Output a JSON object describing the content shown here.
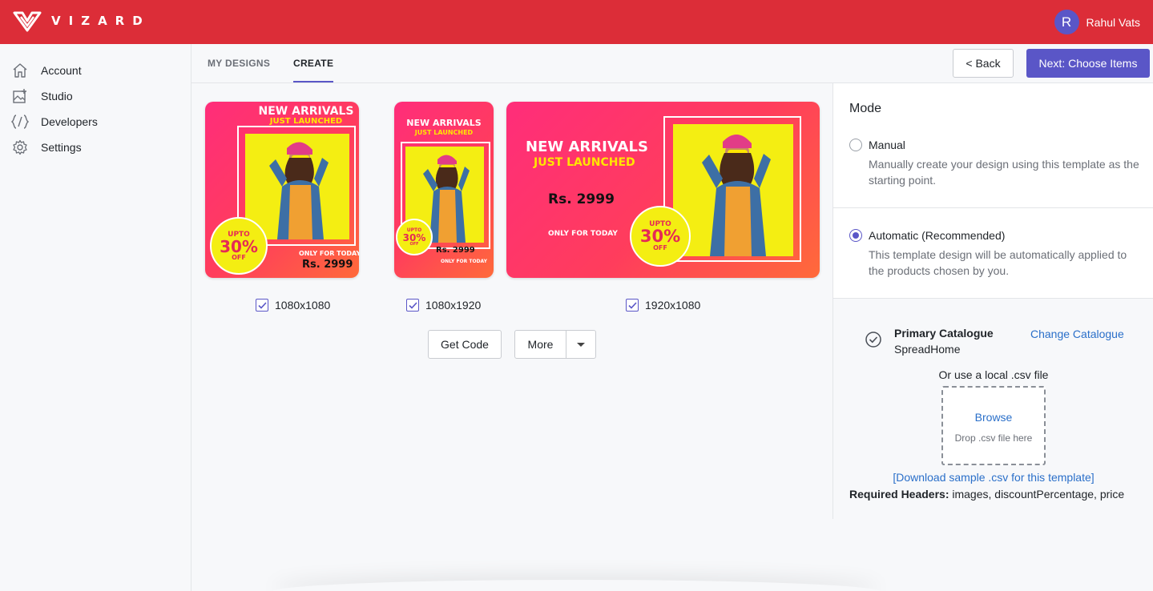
{
  "app": {
    "logo_text": "VIZARD"
  },
  "user": {
    "initial": "R",
    "name": "Rahul Vats"
  },
  "sidebar": {
    "items": [
      {
        "label": "Account",
        "icon": "home-icon"
      },
      {
        "label": "Studio",
        "icon": "studio-icon"
      },
      {
        "label": "Developers",
        "icon": "code-icon"
      },
      {
        "label": "Settings",
        "icon": "gear-icon"
      }
    ]
  },
  "tabs": {
    "my_designs": "MY DESIGNS",
    "create": "CREATE",
    "active": "CREATE"
  },
  "header": {
    "back_label": "< Back",
    "next_label": "Next: Choose Items"
  },
  "designs": [
    {
      "size": "1080x1080",
      "checked": true,
      "headline": "NEW ARRIVALS",
      "sub": "JUST LAUNCHED",
      "price": "Rs. 2999",
      "only": "ONLY FOR TODAY",
      "badge_top": "UPTO",
      "badge_pct": "30%",
      "badge_bottom": "OFF"
    },
    {
      "size": "1080x1920",
      "checked": true,
      "headline": "NEW ARRIVALS",
      "sub": "JUST LAUNCHED",
      "price": "Rs. 2999",
      "only": "ONLY FOR TODAY",
      "badge_top": "UPTO",
      "badge_pct": "30%",
      "badge_bottom": "OFF"
    },
    {
      "size": "1920x1080",
      "checked": true,
      "headline": "NEW ARRIVALS",
      "sub": "JUST LAUNCHED",
      "price": "Rs. 2999",
      "only": "ONLY FOR TODAY",
      "badge_top": "UPTO",
      "badge_pct": "30%",
      "badge_bottom": "OFF"
    }
  ],
  "actions": {
    "get_code": "Get Code",
    "more": "More"
  },
  "mode": {
    "title": "Mode",
    "options": [
      {
        "label": "Manual",
        "description": "Manually create your design using this template as the starting point.",
        "selected": false
      },
      {
        "label": "Automatic (Recommended)",
        "description": "This template design will be automatically applied to the products chosen by you.",
        "selected": true
      }
    ]
  },
  "catalogue": {
    "title": "Primary Catalogue",
    "name": "SpreadHome",
    "change_label": "Change Catalogue",
    "local_csv_label": "Or use a local .csv file",
    "browse_label": "Browse",
    "drop_text": "Drop .csv file here",
    "download_label": "[Download sample .csv for this template]",
    "required_headers_label": "Required Headers:",
    "required_headers_value": " images, discountPercentage, price"
  },
  "colors": {
    "brand_red": "#dc2d38",
    "accent": "#5a56c7",
    "link": "#2a6fc9"
  }
}
